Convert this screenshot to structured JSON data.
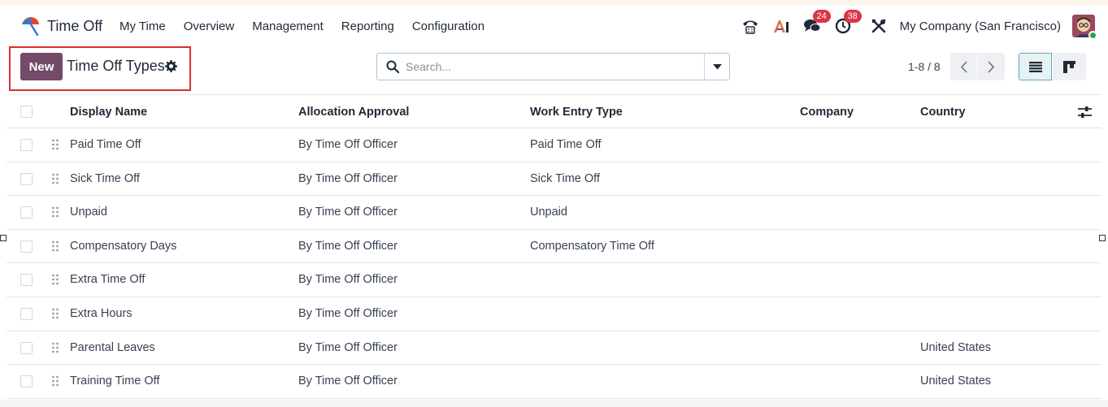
{
  "navbar": {
    "app_name": "Time Off",
    "menu": [
      "My Time",
      "Overview",
      "Management",
      "Reporting",
      "Configuration"
    ],
    "chat_badge": "24",
    "activity_badge": "38",
    "company": "My Company (San Francisco)"
  },
  "control_panel": {
    "new_label": "New",
    "title": "Time Off Types",
    "search_placeholder": "Search...",
    "pager": "1-8 / 8"
  },
  "table": {
    "columns": [
      "Display Name",
      "Allocation Approval",
      "Work Entry Type",
      "Company",
      "Country"
    ],
    "rows": [
      {
        "name": "Paid Time Off",
        "allocation": "By Time Off Officer",
        "work_entry": "Paid Time Off",
        "company": "",
        "country": ""
      },
      {
        "name": "Sick Time Off",
        "allocation": "By Time Off Officer",
        "work_entry": "Sick Time Off",
        "company": "",
        "country": ""
      },
      {
        "name": "Unpaid",
        "allocation": "By Time Off Officer",
        "work_entry": "Unpaid",
        "company": "",
        "country": ""
      },
      {
        "name": "Compensatory Days",
        "allocation": "By Time Off Officer",
        "work_entry": "Compensatory Time Off",
        "company": "",
        "country": ""
      },
      {
        "name": "Extra Time Off",
        "allocation": "By Time Off Officer",
        "work_entry": "",
        "company": "",
        "country": ""
      },
      {
        "name": "Extra Hours",
        "allocation": "By Time Off Officer",
        "work_entry": "",
        "company": "",
        "country": ""
      },
      {
        "name": "Parental Leaves",
        "allocation": "By Time Off Officer",
        "work_entry": "",
        "company": "",
        "country": "United States"
      },
      {
        "name": "Training Time Off",
        "allocation": "By Time Off Officer",
        "work_entry": "",
        "company": "",
        "country": "United States"
      }
    ]
  },
  "colors": {
    "brand": "#714b67",
    "highlight": "#d62f2f",
    "badge": "#dc3545",
    "status_online": "#28a745"
  },
  "icons": {
    "app": "umbrella-icon",
    "phone": "phone-icon",
    "ai": "ai-icon",
    "chat": "chat-icon",
    "activity": "clock-icon",
    "debug": "tools-icon",
    "settings": "gear-icon",
    "search": "search-icon",
    "dropdown": "caret-down-icon",
    "prev": "chevron-left-icon",
    "next": "chevron-right-icon",
    "list_view": "list-view-icon",
    "kanban_view": "kanban-view-icon",
    "optional_columns": "sliders-icon",
    "drag": "drag-handle-icon"
  }
}
